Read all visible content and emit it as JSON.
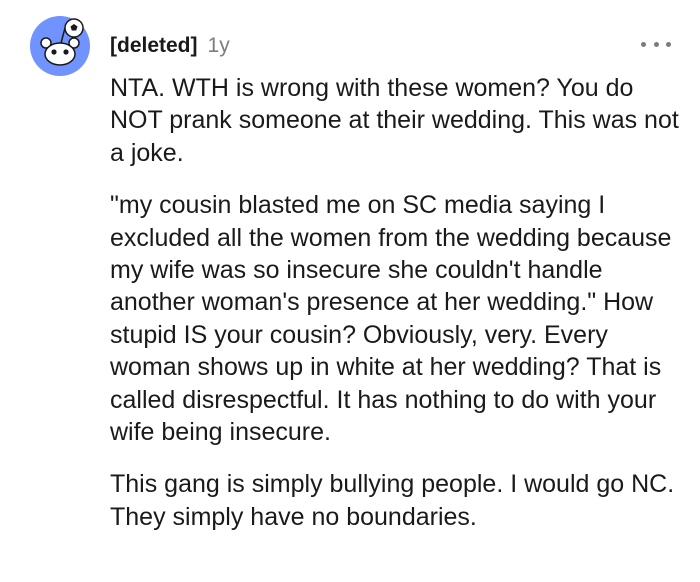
{
  "comment": {
    "author": "[deleted]",
    "age": "1y",
    "more_icon": "more-horizontal-icon",
    "avatar_icon": "snoo-avatar-icon",
    "paragraphs": [
      "NTA. WTH is wrong with these women? You do NOT prank someone at their wedding. This was not a joke.",
      "\"my cousin blasted me on SC media saying I excluded all the women from the wedding because my wife was so insecure she couldn't handle another woman's presence at her wedding.\" How stupid IS your cousin? Obviously, very. Every woman shows up in white at her wedding? That is called disrespectful. It has nothing to do with your wife being insecure.",
      "This gang is simply bullying people. I would go NC. They simply have no boundaries."
    ]
  },
  "colors": {
    "avatar_bg": "#7193ff",
    "text": "#1a1a1b",
    "meta": "#7c7c7c"
  }
}
